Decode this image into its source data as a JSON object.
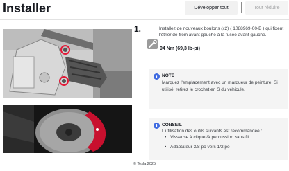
{
  "header": {
    "title": "Installer",
    "expand_all_label": "Développer tout",
    "collapse_all_label": "Tout réduire"
  },
  "step": {
    "number": "1.",
    "text": "Installez de nouveaux boulons (x2) ( 1088969-00-B ) qui fixent l'étrier de frein avant gauche à la fusée avant gauche.",
    "torque_icon": "torque-wrench-icon",
    "torque": "94 Nm (69,3 lb-pi)"
  },
  "note": {
    "icon": "info-icon",
    "title": "NOTE",
    "text": "Marquez l'emplacement avec un marqueur de peinture. Si utilisé, retirez le crochet en S du véhicule."
  },
  "tip": {
    "icon": "info-icon",
    "title": "CONSEIL",
    "text": "L'utilisation des outils suivants est recommandée :",
    "items": [
      "Visseuse à cliquet/à percussion sans fil",
      "Adaptateur 3/8 po vers 1/2 po"
    ]
  },
  "footer": {
    "copyright": "© Tesla 2025"
  },
  "colors": {
    "accent_blue": "#3e6ae1",
    "highlight_red": "#e31937",
    "callout_bg": "#f4f4f4",
    "caliper_red": "#c8102e"
  }
}
